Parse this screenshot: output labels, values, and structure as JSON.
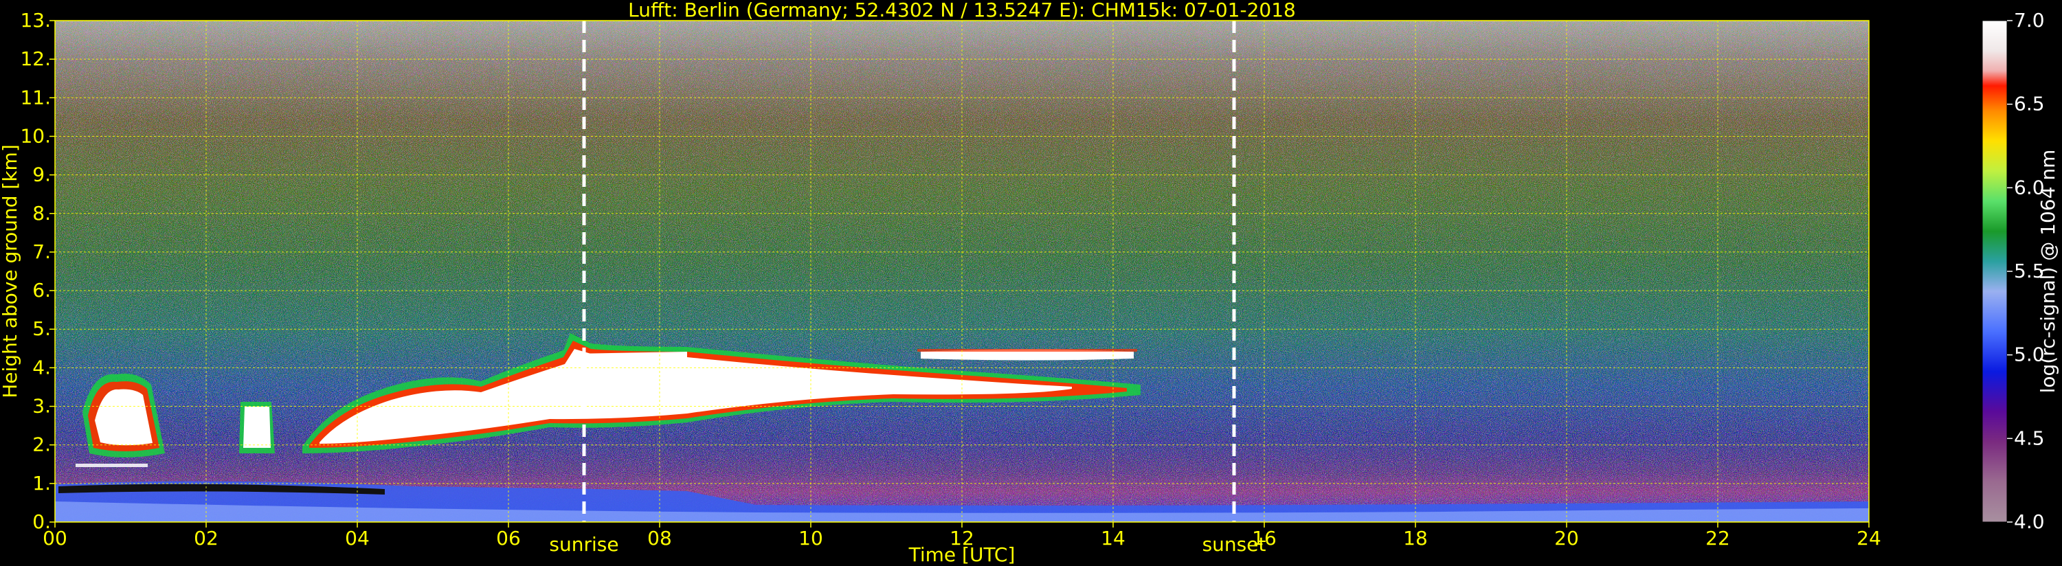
{
  "chart_data": {
    "type": "heatmap",
    "title": "Lufft: Berlin (Germany; 52.4302 N / 13.5247 E):    CHM15k: 07-01-2018",
    "xlabel": "Time [UTC]",
    "ylabel": "Height above ground [km]",
    "xlim": [
      0,
      24
    ],
    "ylim": [
      0,
      13
    ],
    "x_ticks": [
      "00",
      "02",
      "04",
      "06",
      "08",
      "10",
      "12",
      "14",
      "16",
      "18",
      "20",
      "22",
      "24"
    ],
    "y_ticks": [
      "0.",
      "1.",
      "2.",
      "3.",
      "4.",
      "5.",
      "6.",
      "7.",
      "8.",
      "9.",
      "10.",
      "11.",
      "12.",
      "13."
    ],
    "grid": true,
    "colorbar": {
      "label": "log(rc-signal) @ 1064 nm",
      "range": [
        4.0,
        7.0
      ],
      "ticks": [
        "4.0",
        "4.5",
        "5.0",
        "5.5",
        "6.0",
        "6.5",
        "7.0"
      ]
    },
    "markers": [
      {
        "label": "sunrise",
        "x": 7.0
      },
      {
        "label": "sunset",
        "x": 15.6
      }
    ],
    "colors": {
      "grid": "#ffff00",
      "markers": "#ffffff",
      "text": "#ffff00"
    }
  }
}
